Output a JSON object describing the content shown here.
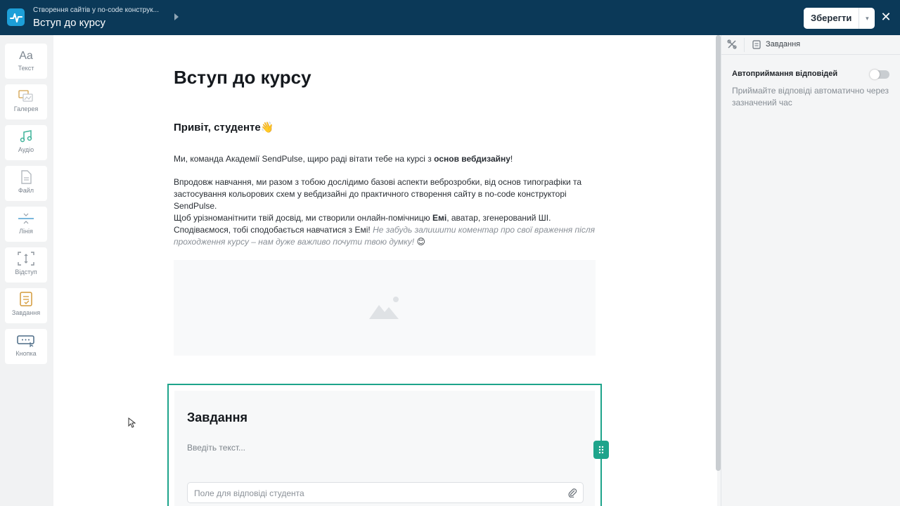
{
  "header": {
    "breadcrumb": "Створення сайтів у no-code конструк...",
    "title": "Вступ до курсу",
    "save_label": "Зберегти",
    "close_label": "✕"
  },
  "tools": [
    {
      "label": "Текст",
      "icon": "text-icon"
    },
    {
      "label": "Галерея",
      "icon": "gallery-icon"
    },
    {
      "label": "Аудіо",
      "icon": "audio-icon"
    },
    {
      "label": "Файл",
      "icon": "file-icon"
    },
    {
      "label": "Лінія",
      "icon": "line-icon"
    },
    {
      "label": "Відступ",
      "icon": "spacing-icon"
    },
    {
      "label": "Завдання",
      "icon": "task-icon"
    },
    {
      "label": "Кнопка",
      "icon": "button-icon"
    }
  ],
  "content": {
    "heading": "Вступ до курсу",
    "greeting": "Привіт, студенте",
    "greeting_emoji": "👋",
    "p1_a": "Ми, команда Академії SendPulse, щиро раді вітати тебе на курсі з ",
    "p1_b": "основ вебдизайну",
    "p1_c": "!",
    "p2": "Впродовж навчання, ми разом з тобою дослідимо базові аспекти веброзробки, від основ типографіки та застосування кольорових схем у вебдизайні до практичного створення сайту в no-code конструкторі SendPulse.",
    "p3_a": "Щоб урізноманітнити твій досвід, ми створили онлайн-помічницю ",
    "p3_b": "Емі",
    "p3_c": ", аватар, згенерований ШІ. Сподіваємося, тобі сподобається навчатися з Емі! ",
    "p3_i": "Не забудь залишити коментар про свої враження після проходження курсу – нам дуже важливо почути твою думку!",
    "p3_emoji": "😊"
  },
  "task": {
    "title": "Завдання",
    "description_placeholder": "Введіть текст...",
    "answer_placeholder": "Поле для відповіді студента"
  },
  "panel": {
    "tab_label": "Завдання",
    "auto_accept_title": "Автоприймання відповідей",
    "auto_accept_desc": "Приймайте відповіді автоматично через зазначений час",
    "auto_accept_enabled": false
  },
  "colors": {
    "topbar": "#0b3958",
    "accent": "#1ea48b",
    "logo": "#1d9fd8"
  }
}
